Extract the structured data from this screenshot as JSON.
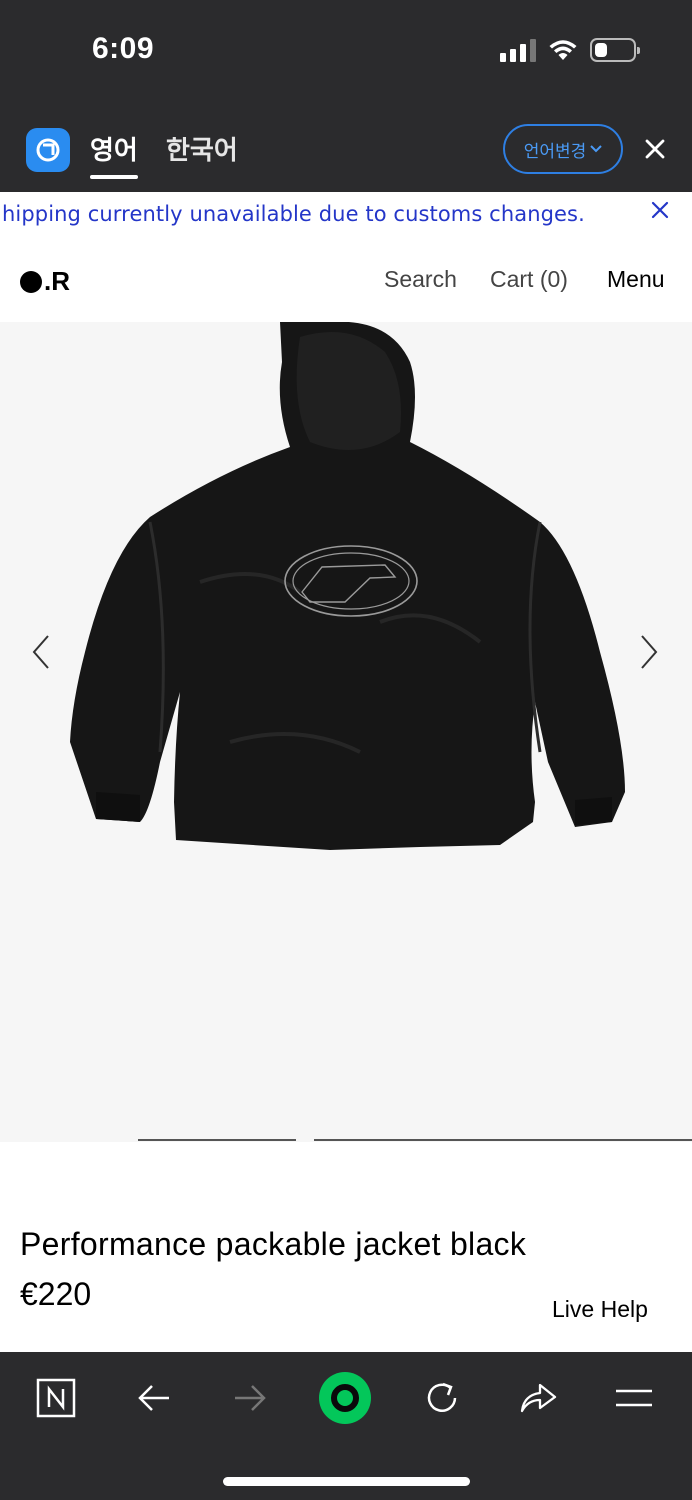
{
  "status_bar": {
    "time": "6:09"
  },
  "translate_bar": {
    "tabs": [
      {
        "label": "영어",
        "active": true
      },
      {
        "label": "한국어",
        "active": false
      }
    ],
    "change_language_label": "언어변경"
  },
  "banner": {
    "text": "hipping currently unavailable due to customs changes."
  },
  "header": {
    "logo_text": ".R",
    "nav": {
      "search": "Search",
      "cart": "Cart (0)",
      "menu": "Menu"
    }
  },
  "product": {
    "title": "Performance packable jacket black",
    "price": "€220",
    "live_help": "Live Help"
  },
  "colors": {
    "browser_chrome": "#2b2b2d",
    "accent_blue": "#2a8cf0",
    "banner_text": "#2436c8",
    "naver_green": "#03c75a"
  },
  "icons": {
    "toolbar": [
      "naver-n-icon",
      "back-arrow-icon",
      "forward-arrow-icon",
      "naver-green-dot-icon",
      "reload-icon",
      "share-icon",
      "menu-lines-icon"
    ]
  }
}
